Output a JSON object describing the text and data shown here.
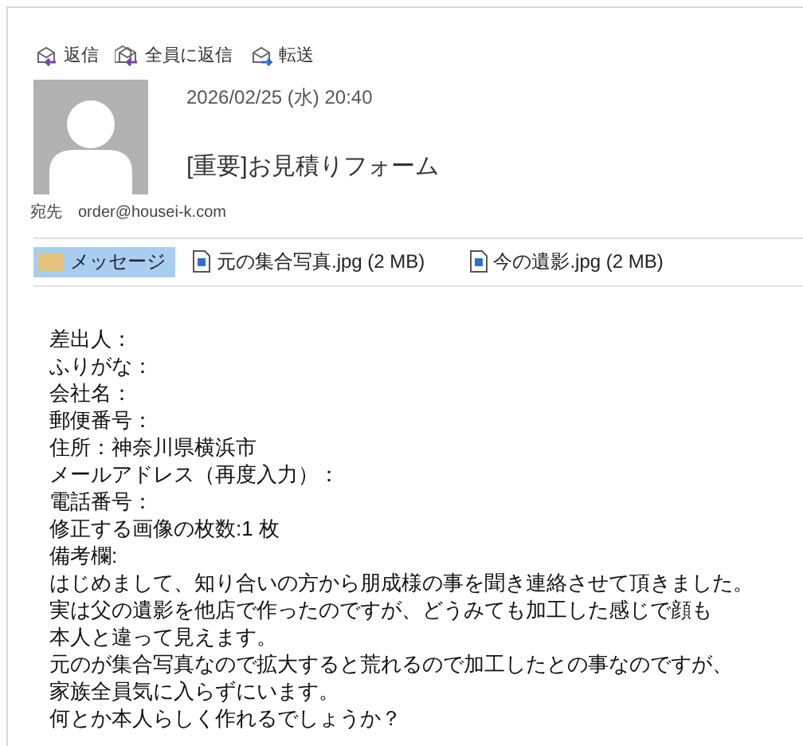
{
  "actions": [
    {
      "label": "返信",
      "kind": "reply"
    },
    {
      "label": "全員に返信",
      "kind": "reply_all"
    },
    {
      "label": "転送",
      "kind": "forward"
    }
  ],
  "date": "2026/02/25 (水) 20:40",
  "subject": "[重要]お見積りフォーム",
  "to": {
    "label": "宛先",
    "address": "order@housei-k.com"
  },
  "attachments": [
    {
      "label": "メッセージ",
      "kind": "message",
      "selected": true
    },
    {
      "label": "元の集合写真.jpg (2 MB)",
      "kind": "file",
      "selected": false
    },
    {
      "label": "今の遺影.jpg (2 MB)",
      "kind": "file",
      "selected": false
    }
  ],
  "body": [
    "差出人：",
    "ふりがな：",
    "会社名：",
    "郵便番号：",
    "住所：神奈川県横浜市",
    "メールアドレス（再度入力）：",
    "電話番号：",
    "修正する画像の枚数:1 枚",
    "備考欄:",
    "はじめまして、知り合いの方から朋成様の事を聞き連絡させて頂きました。",
    "実は父の遺影を他店で作ったのですが、どうみても加工した感じで顔も",
    "本人と違って見えます。",
    "元のが集合写真なので拡大すると荒れるので加工したとの事なのですが、",
    "家族全員気に入らずにいます。",
    "何とか本人らしく作れるでしょうか？"
  ]
}
